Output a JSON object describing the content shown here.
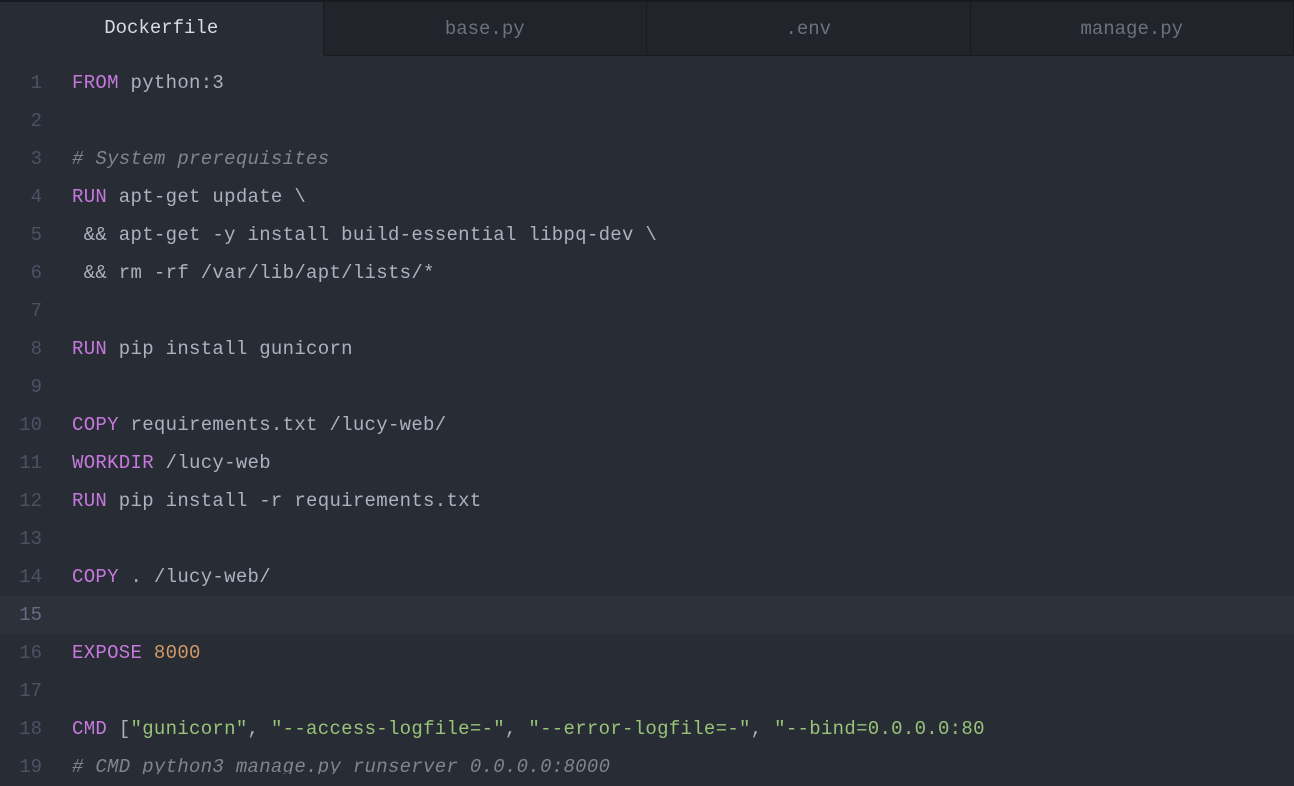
{
  "tabs": [
    {
      "label": "Dockerfile",
      "active": true
    },
    {
      "label": "base.py",
      "active": false
    },
    {
      "label": ".env",
      "active": false
    },
    {
      "label": "manage.py",
      "active": false
    }
  ],
  "currentLine": 15,
  "code": {
    "l1_kw": "FROM",
    "l1_rest": " python:3",
    "l3_comment": "# System prerequisites",
    "l4_kw": "RUN",
    "l4_rest": " apt-get update \\",
    "l5": " && apt-get -y install build-essential libpq-dev \\",
    "l6": " && rm -rf /var/lib/apt/lists/*",
    "l8_kw": "RUN",
    "l8_rest": " pip install gunicorn",
    "l10_kw": "COPY",
    "l10_rest": " requirements.txt /lucy-web/",
    "l11_kw": "WORKDIR",
    "l11_rest": " /lucy-web",
    "l12_kw": "RUN",
    "l12_rest": " pip install -r requirements.txt",
    "l14_kw": "COPY",
    "l14_rest": " . /lucy-web/",
    "l16_kw": "EXPOSE",
    "l16_rest": " ",
    "l16_num": "8000",
    "l18_kw": "CMD",
    "l18_a": " [",
    "l18_s1": "\"gunicorn\"",
    "l18_c1": ", ",
    "l18_s2": "\"--access-logfile=-\"",
    "l18_c2": ", ",
    "l18_s3": "\"--error-logfile=-\"",
    "l18_c3": ", ",
    "l18_s4": "\"--bind=0.0.0.0:80",
    "l19_comment": "# CMD python3 manage.py runserver 0.0.0.0:8000"
  },
  "lineNumbers": [
    "1",
    "2",
    "3",
    "4",
    "5",
    "6",
    "7",
    "8",
    "9",
    "10",
    "11",
    "12",
    "13",
    "14",
    "15",
    "16",
    "17",
    "18",
    "19"
  ]
}
